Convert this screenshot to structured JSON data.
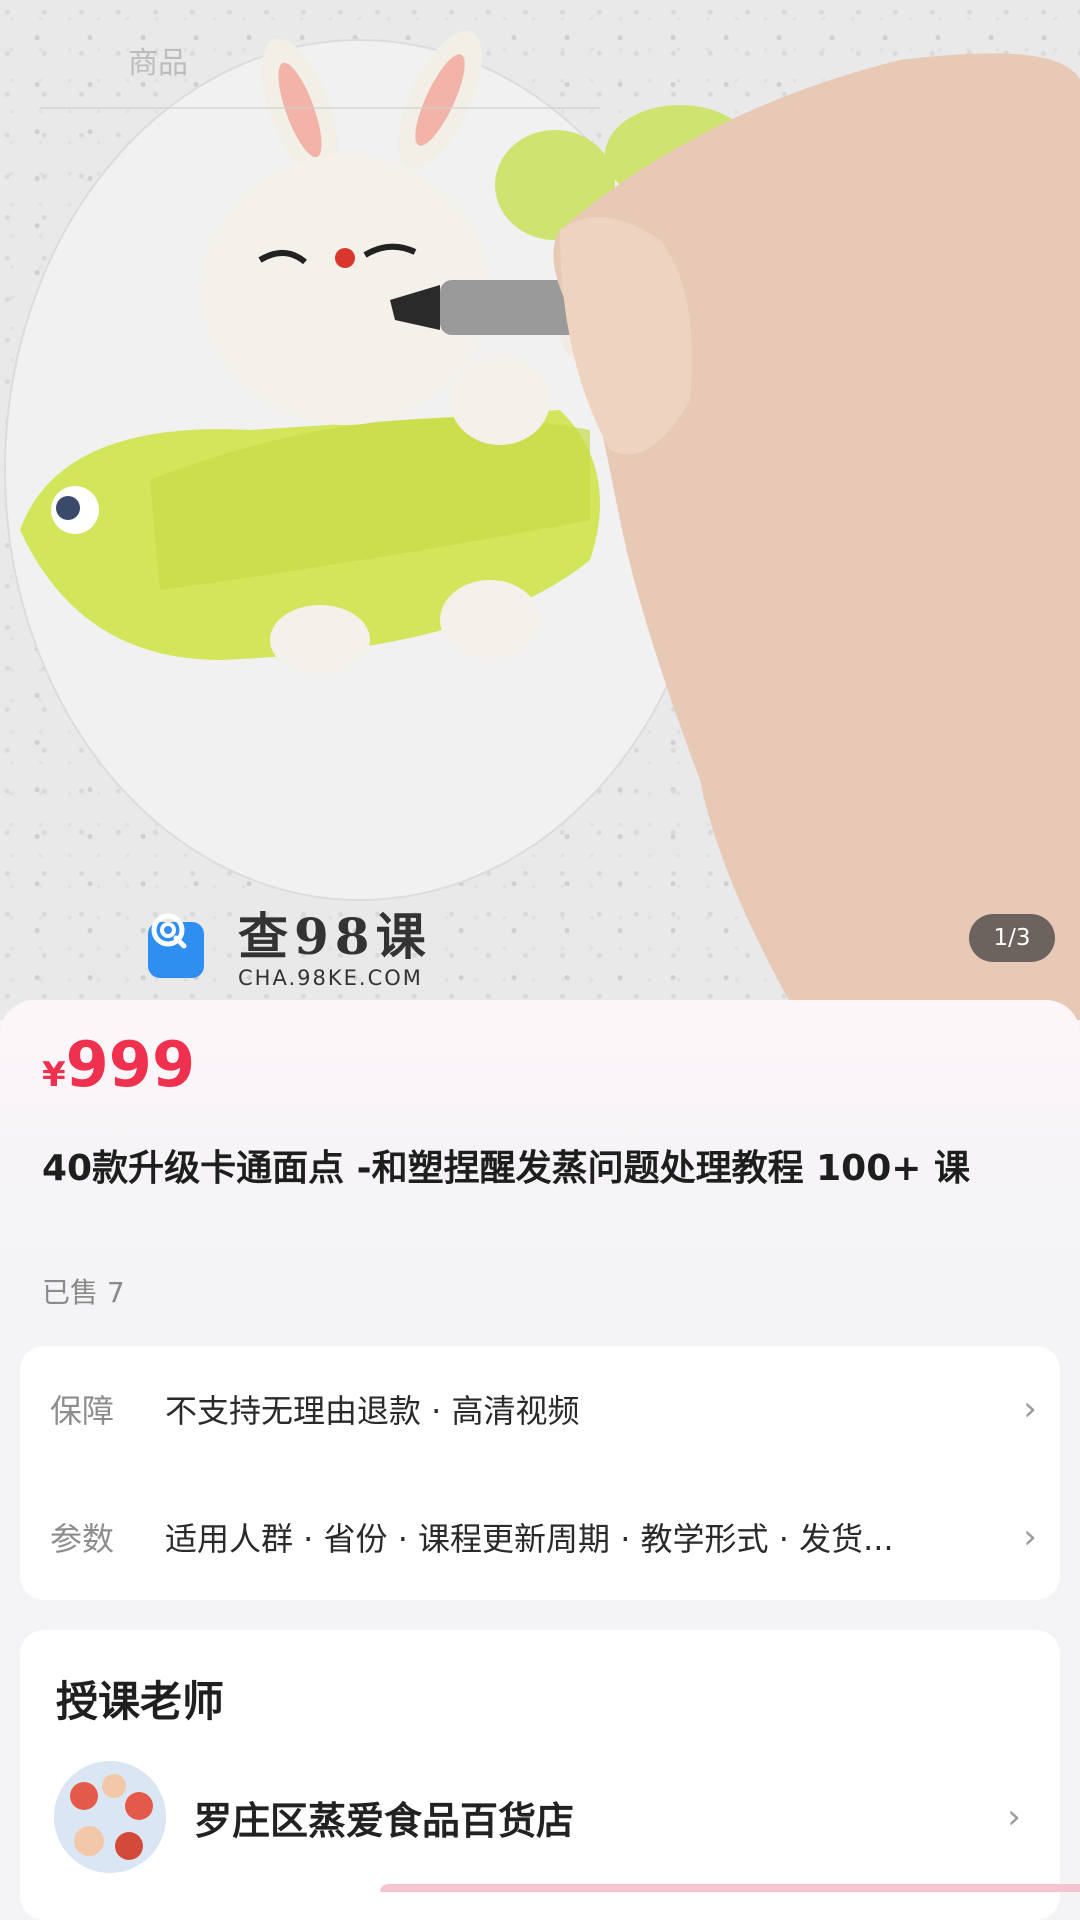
{
  "hero": {
    "tab_label": "商品",
    "image_counter": "1/3",
    "watermark_title": "查98课",
    "watermark_sub": "CHA.98KE.COM"
  },
  "product": {
    "currency": "¥",
    "price": "999",
    "title": "40款升级卡通面点 -和塑捏醒发蒸问题处理教程 100+ 课",
    "sold": "已售 7"
  },
  "info_rows": [
    {
      "label": "保障",
      "text": "不支持无理由退款 · 高清视频"
    },
    {
      "label": "参数",
      "text": "适用人群 · 省份 · 课程更新周期 · 教学形式 · 发货..."
    }
  ],
  "teacher_section": {
    "title": "授课老师",
    "teacher_name": "罗庄区蒸爱食品百货店"
  },
  "colors": {
    "price": "#f0304f",
    "accent_pink": "#f6c4cf"
  }
}
